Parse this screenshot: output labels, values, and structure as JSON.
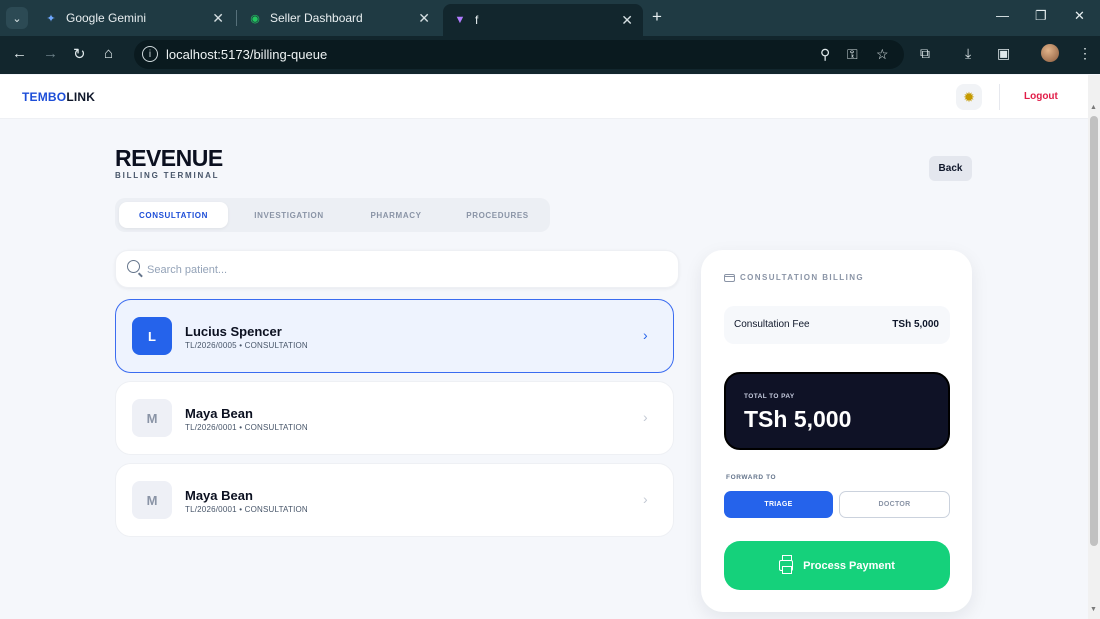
{
  "browser": {
    "tabs": [
      {
        "title": "Google Gemini",
        "icon": "gemini-icon"
      },
      {
        "title": "Seller Dashboard",
        "icon": "dashboard-icon"
      },
      {
        "title": "f",
        "icon": "vite-icon"
      }
    ],
    "url": "localhost:5173/billing-queue"
  },
  "header": {
    "logo_part1": "TEMBO",
    "logo_part2": "LINK",
    "logout": "Logout"
  },
  "page": {
    "title": "REVENUE",
    "subtitle": "BILLING TERMINAL",
    "back": "Back"
  },
  "tabs": [
    "CONSULTATION",
    "INVESTIGATION",
    "PHARMACY",
    "PROCEDURES"
  ],
  "search": {
    "placeholder": "Search patient..."
  },
  "patients": [
    {
      "initial": "L",
      "name": "Lucius Spencer",
      "meta": "TL/2026/0005 • CONSULTATION"
    },
    {
      "initial": "M",
      "name": "Maya Bean",
      "meta": "TL/2026/0001 • CONSULTATION"
    },
    {
      "initial": "M",
      "name": "Maya Bean",
      "meta": "TL/2026/0001 • CONSULTATION"
    }
  ],
  "billing": {
    "heading": "CONSULTATION BILLING",
    "fee_label": "Consultation Fee",
    "fee_value": "TSh 5,000",
    "total_label": "TOTAL TO PAY",
    "total_value": "TSh 5,000",
    "forward_label": "FORWARD TO",
    "forward_options": [
      "TRIAGE",
      "DOCTOR"
    ],
    "pay_label": "Process Payment"
  },
  "colors": {
    "brand_blue": "#2563eb",
    "pay_green": "#15d17b",
    "logout_red": "#e11d48",
    "total_dark": "#0f1226"
  }
}
